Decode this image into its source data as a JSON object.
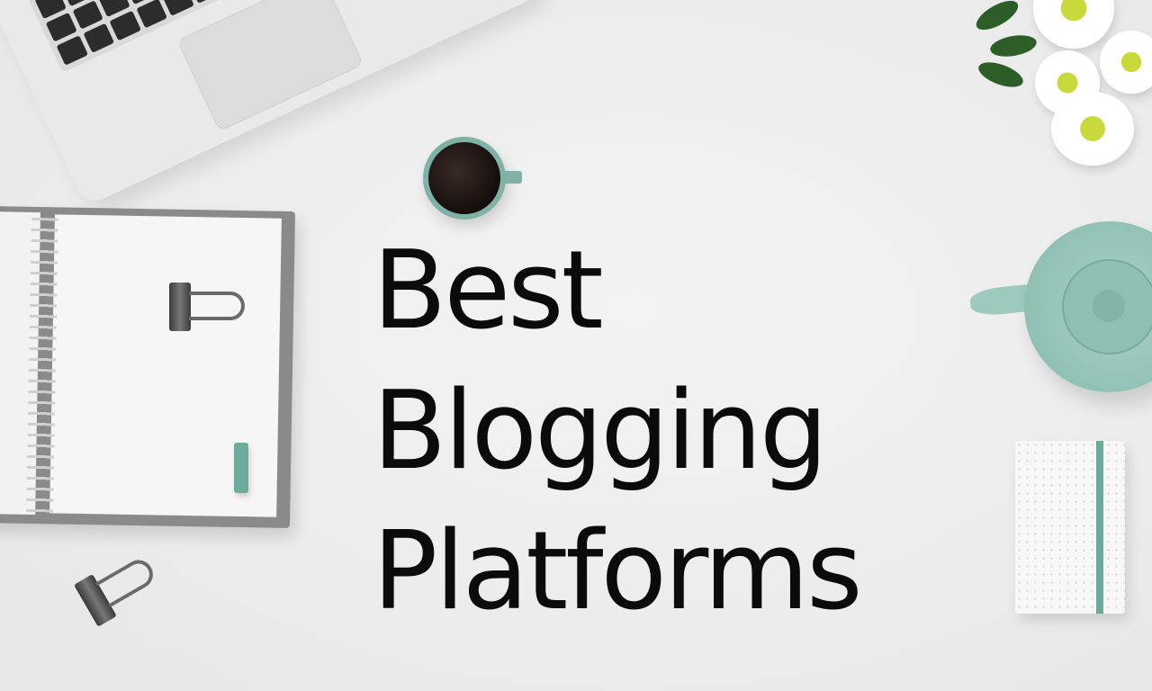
{
  "title": {
    "line1": "Best",
    "line2": "Blogging",
    "line3": "Platforms"
  },
  "colors": {
    "background": "#ececec",
    "accent_teal": "#8fbfb4",
    "text": "#0b0b0b"
  }
}
